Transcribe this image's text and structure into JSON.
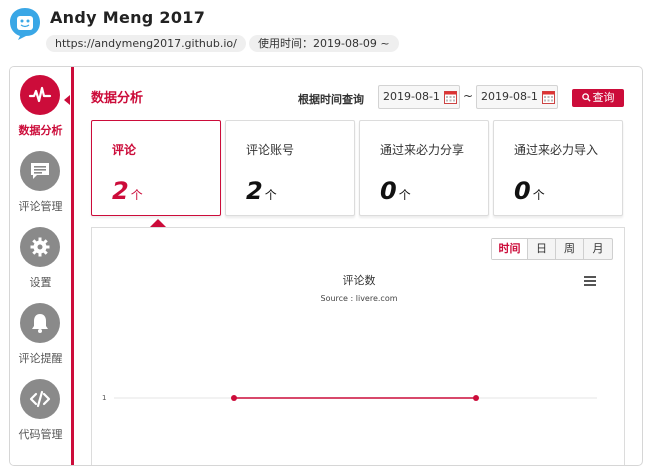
{
  "app": {
    "title": "Andy Meng 2017",
    "url": "https://andymeng2017.github.io/",
    "usage_time": "使用时间：2019-08-09 ~"
  },
  "sidebar": {
    "items": [
      {
        "label": "数据分析",
        "icon": "pulse-icon"
      },
      {
        "label": "评论管理",
        "icon": "comment-icon"
      },
      {
        "label": "设置",
        "icon": "gear-icon"
      },
      {
        "label": "评论提醒",
        "icon": "bell-icon"
      },
      {
        "label": "代码管理",
        "icon": "code-icon"
      }
    ]
  },
  "main": {
    "section_title": "数据分析",
    "query_label": "根据时间查询",
    "date_from": "2019-08-1",
    "tilde": "~",
    "date_to": "2019-08-1",
    "query_button": "查询"
  },
  "cards": [
    {
      "label": "评论",
      "value": "2",
      "unit": "个"
    },
    {
      "label": "评论账号",
      "value": "2",
      "unit": "个"
    },
    {
      "label": "通过来必力分享",
      "value": "0",
      "unit": "个"
    },
    {
      "label": "通过来必力导入",
      "value": "0",
      "unit": "个"
    }
  ],
  "chart": {
    "range_tabs": [
      "时间",
      "日",
      "周",
      "月"
    ],
    "active_tab": "时间"
  },
  "chart_data": {
    "type": "line",
    "title": "评论数",
    "subtitle": "Source : livere.com",
    "xlabel": "",
    "ylabel": "",
    "y_tick_labels": [
      "1"
    ],
    "series": [
      {
        "values": [
          1,
          1
        ]
      }
    ],
    "grid": true
  },
  "colors": {
    "accent": "#cc0c3a",
    "icon_gray": "#8a8a8a",
    "logo_blue": "#3aa7e6"
  }
}
